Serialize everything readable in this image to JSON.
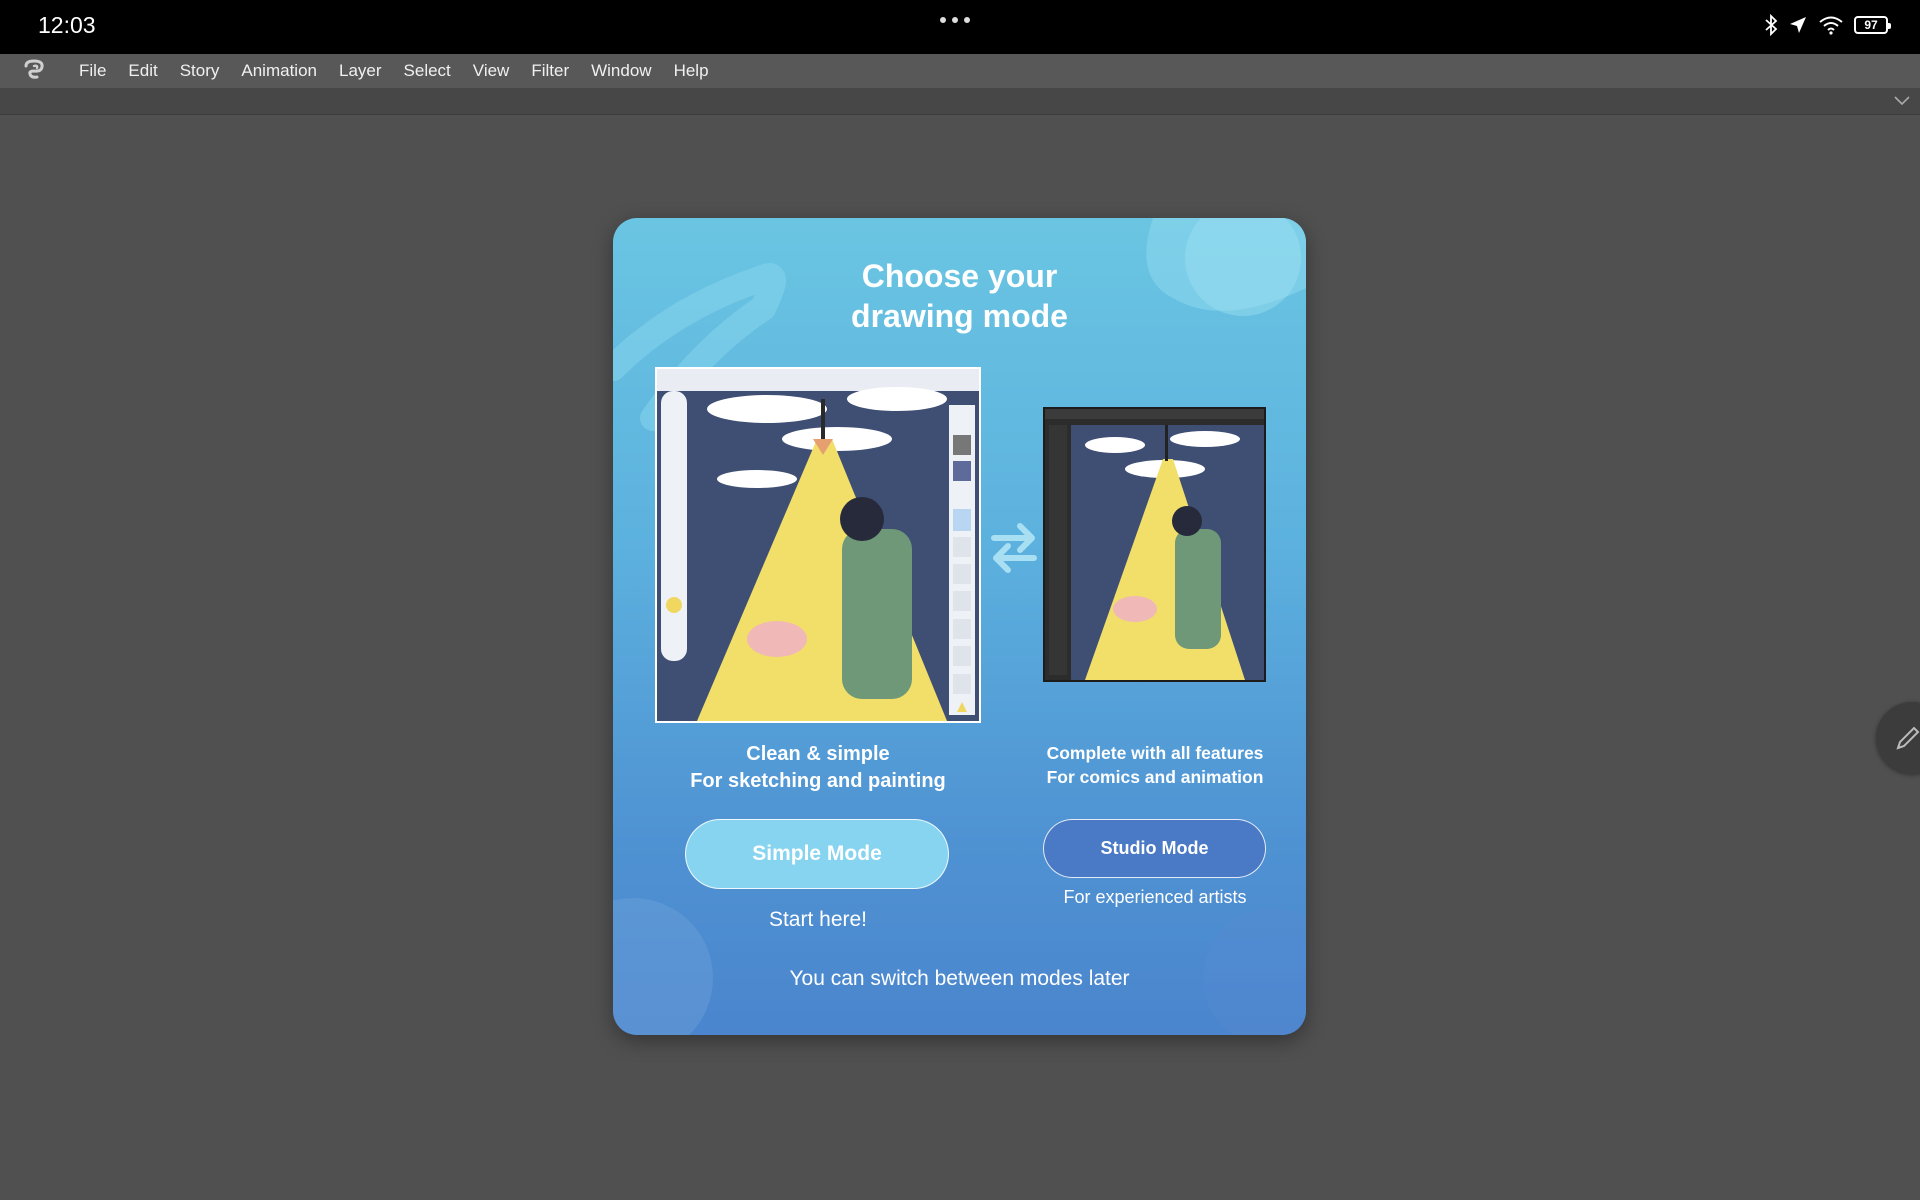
{
  "status_bar": {
    "time": "12:03",
    "battery": "97",
    "icons": [
      "bluetooth-icon",
      "location-icon",
      "wifi-icon",
      "battery-icon"
    ]
  },
  "menu": {
    "items": [
      "File",
      "Edit",
      "Story",
      "Animation",
      "Layer",
      "Select",
      "View",
      "Filter",
      "Window",
      "Help"
    ]
  },
  "dialog": {
    "title_line1": "Choose your",
    "title_line2": "drawing mode",
    "simple": {
      "caption_line1": "Clean & simple",
      "caption_line2": "For sketching and painting",
      "button": "Simple Mode",
      "note": "Start here!"
    },
    "studio": {
      "caption_line1": "Complete with all features",
      "caption_line2": "For comics and animation",
      "button": "Studio Mode",
      "note": "For experienced artists"
    },
    "footer": "You can switch between modes later"
  },
  "colors": {
    "dialog_top": "#6ac5e2",
    "dialog_bottom": "#4a85cd",
    "simple_button": "#86d4ef",
    "studio_button": "#4a79c6",
    "workspace": "#505050"
  }
}
